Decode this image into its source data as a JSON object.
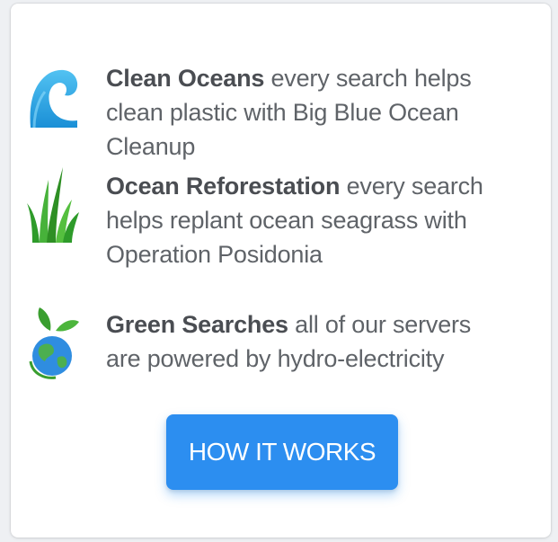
{
  "features": [
    {
      "icon": "wave-icon",
      "title": "Clean Oceans",
      "description": " every search helps clean plastic with Big Blue Ocean Cleanup"
    },
    {
      "icon": "seagrass-icon",
      "title": "Ocean Reforestation",
      "description": " every search helps replant ocean seagrass with Operation Posidonia"
    },
    {
      "icon": "green-earth-icon",
      "title": "Green Searches",
      "description": " all of our servers are powered by hydro-electricity"
    }
  ],
  "cta": {
    "label": "HOW IT WORKS"
  },
  "colors": {
    "button": "#2c8ef0",
    "text": "#5f6368",
    "wave": "#29a8e8",
    "grass": "#3aa12b",
    "leaf": "#48b43a"
  }
}
